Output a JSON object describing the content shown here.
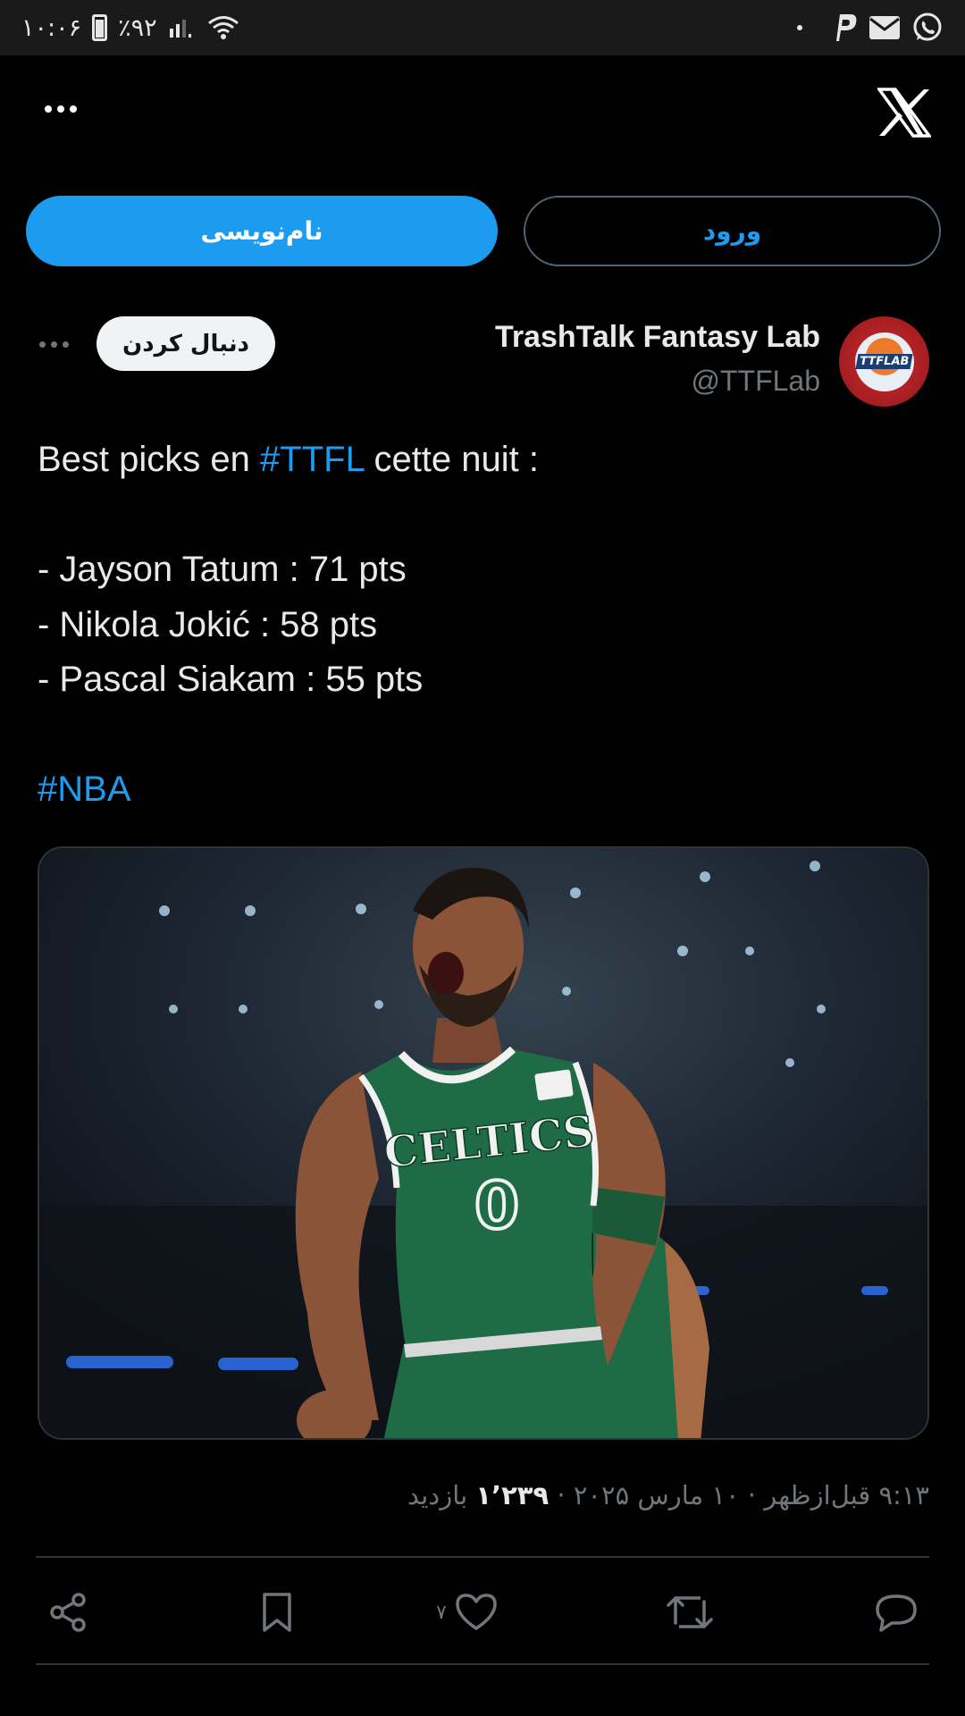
{
  "status_bar": {
    "time": "۱۰:۰۶",
    "battery": "٪۹۲"
  },
  "header": {
    "more_icon": "more-dots-icon",
    "logo_icon": "x-logo-icon"
  },
  "auth": {
    "signup_label": "نام‌نویسی",
    "login_label": "ورود"
  },
  "author": {
    "name": "TrashTalk Fantasy Lab",
    "handle": "@TTFLab",
    "avatar_text": "TTFLAB",
    "follow_label": "دنبال کردن"
  },
  "tweet": {
    "line1_before": "Best picks en ",
    "line1_hashtag": "#TTFL",
    "line1_after": " cette nuit :",
    "picks": [
      "- Jayson Tatum : 71 pts",
      "- Nikola Jokić : 58 pts",
      "- Pascal Siakam : 55 pts"
    ],
    "hashtag2": "#NBA"
  },
  "media": {
    "jersey_team": "CELTICS",
    "jersey_number": "0",
    "colors": {
      "jersey": "#1e6b45",
      "trim": "#f1f1f1"
    }
  },
  "meta": {
    "time": "۹:۱۳ قبل‌ازظهر",
    "separator": "·",
    "date": "۱۰ مارس ۲۰۲۵",
    "views_count": "۱٬۲۳۹",
    "views_label": "بازدید"
  },
  "actions": {
    "like_count": "۷"
  },
  "colors": {
    "accent": "#1d9bf0",
    "background": "#000000",
    "muted": "#71767b"
  }
}
